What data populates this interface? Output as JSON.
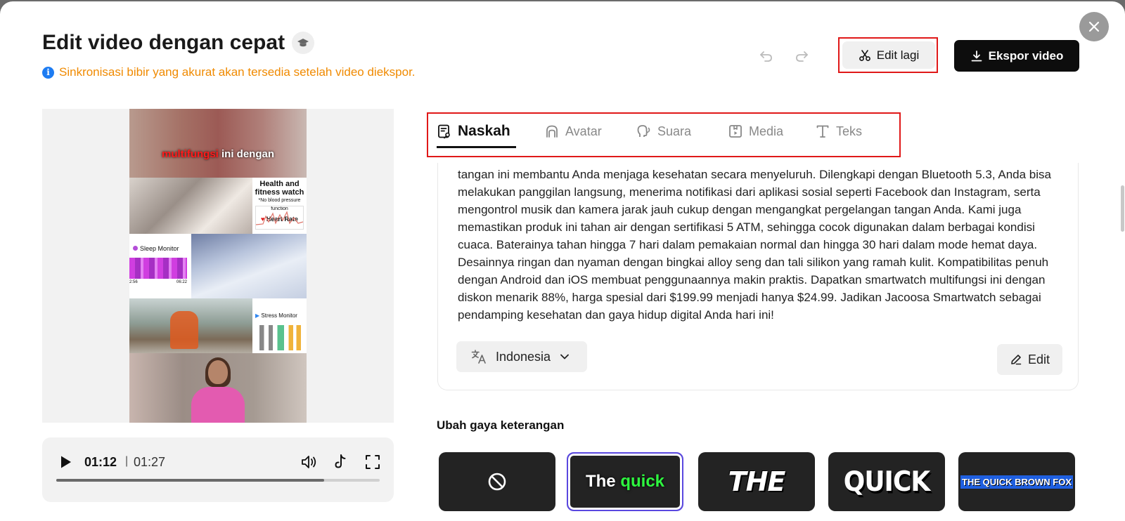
{
  "header": {
    "title": "Edit video dengan cepat",
    "notice": "Sinkronisasi bibir yang akurat akan tersedia setelah video diekspor.",
    "edit_again_label": "Edit lagi",
    "export_label": "Ekspor video"
  },
  "preview": {
    "caption_highlight": "multifungsi",
    "caption_rest": " ini dengan",
    "card1_title": "Health and fitness watch",
    "card1_note": "*No blood pressure function",
    "card1_metric": "Heart Rate",
    "card2_title": "Sleep Monitor",
    "card2_time_start": "2:56",
    "card2_time_end": "06:22",
    "card3_title": "Stress Monitor"
  },
  "player": {
    "current_time": "01:12",
    "separator": "|",
    "total_time": "01:27",
    "progress": 0.828
  },
  "tabs": [
    {
      "label": "Naskah",
      "icon": "script-icon",
      "active": true
    },
    {
      "label": "Avatar",
      "icon": "avatar-icon",
      "active": false
    },
    {
      "label": "Suara",
      "icon": "voice-icon",
      "active": false
    },
    {
      "label": "Media",
      "icon": "media-icon",
      "active": false
    },
    {
      "label": "Teks",
      "icon": "text-icon",
      "active": false
    }
  ],
  "script": {
    "text": "tangan ini membantu Anda menjaga kesehatan secara menyeluruh. Dilengkapi dengan Bluetooth 5.3, Anda bisa melakukan panggilan langsung, menerima notifikasi dari aplikasi sosial seperti Facebook dan Instagram, serta mengontrol musik dan kamera jarak jauh cukup dengan mengangkat pergelangan tangan Anda. Kami juga memastikan produk ini tahan air dengan sertifikasi 5 ATM, sehingga cocok digunakan dalam berbagai kondisi cuaca. Baterainya tahan hingga 7 hari dalam pemakaian normal dan hingga 30 hari dalam mode hemat daya. Desainnya ringan dan nyaman dengan bingkai alloy seng dan tali silikon yang ramah kulit. Kompatibilitas penuh dengan Android dan iOS membuat penggunaannya makin praktis. Dapatkan smartwatch multifungsi ini dengan diskon menarik 88%, harga spesial dari $199.99 menjadi hanya $24.99. Jadikan Jacoosa Smartwatch sebagai pendamping kesehatan dan gaya hidup digital Anda hari ini!",
    "language": "Indonesia",
    "edit_label": "Edit"
  },
  "caption_styles": {
    "title": "Ubah gaya keterangan",
    "tiles": [
      {
        "label": "",
        "icon": "none-icon"
      },
      {
        "label_white": "The",
        "label_green": "quick",
        "selected": true
      },
      {
        "label": "THE"
      },
      {
        "label": "QUICK"
      },
      {
        "label": "THE QUICK BROWN FOX"
      }
    ]
  },
  "colors": {
    "notice": "#f08a00",
    "highlight_box": "#e01818",
    "selected_style": "#5a48e0",
    "caption_green": "#2ef53f"
  }
}
